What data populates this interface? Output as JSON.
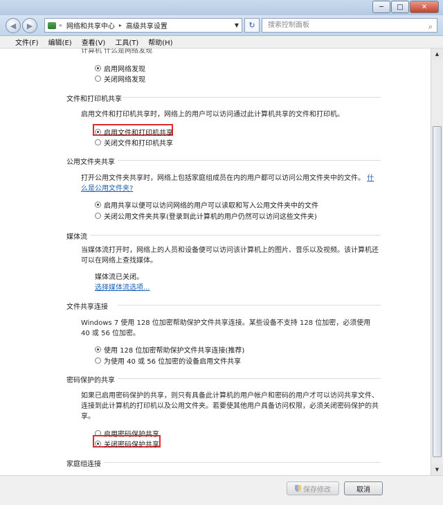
{
  "window": {
    "minimize": "─",
    "maximize": "□",
    "close": "✕"
  },
  "nav": {
    "back_icon": "◀",
    "forward_icon": "▶",
    "breadcrumb": [
      "«",
      "网络和共享中心",
      "▸",
      "高级共享设置"
    ],
    "refresh_icon": "↻",
    "search_placeholder": "搜索控制面板",
    "search_icon": "⌕"
  },
  "menu": [
    "文件(F)",
    "编辑(E)",
    "查看(V)",
    "工具(T)",
    "帮助(H)"
  ],
  "network_discovery": {
    "cut_label": "计算机  什么是网络发现",
    "options": [
      {
        "label": "启用网络发现",
        "selected": true
      },
      {
        "label": "关闭网络发现",
        "selected": false
      }
    ]
  },
  "file_printer": {
    "heading": "文件和打印机共享",
    "desc": "启用文件和打印机共享时，网络上的用户可以访问通过此计算机共享的文件和打印机。",
    "options": [
      {
        "label": "启用文件和打印机共享",
        "selected": true
      },
      {
        "label": "关闭文件和打印机共享",
        "selected": false
      }
    ]
  },
  "public_folder": {
    "heading": "公用文件夹共享",
    "desc": "打开公用文件夹共享时，网络上包括家庭组成员在内的用户都可以访问公用文件夹中的文件。",
    "link": "什么是公用文件夹?",
    "options": [
      {
        "label": "启用共享以便可以访问网络的用户可以读取和写入公用文件夹中的文件",
        "selected": true
      },
      {
        "label": "关闭公用文件夹共享(登录到此计算机的用户仍然可以访问这些文件夹)",
        "selected": false
      }
    ]
  },
  "media": {
    "heading": "媒体流",
    "desc": "当媒体流打开时，网络上的人员和设备便可以访问该计算机上的图片、音乐以及视频。该计算机还可以在网络上查找媒体。",
    "status": "媒体流已关闭。",
    "link": "选择媒体流选项..."
  },
  "file_sharing": {
    "heading": "文件共享连接",
    "desc": "Windows 7 使用 128 位加密帮助保护文件共享连接。某些设备不支持 128 位加密，必须使用 40 或 56 位加密。",
    "options": [
      {
        "label": "使用 128 位加密帮助保护文件共享连接(推荐)",
        "selected": true
      },
      {
        "label": "为使用 40 或 56 位加密的设备启用文件共享",
        "selected": false
      }
    ]
  },
  "password": {
    "heading": "密码保护的共享",
    "desc": "如果已启用密码保护的共享，则只有具备此计算机的用户帐户和密码的用户才可以访问共享文件、连接到此计算机的打印机以及公用文件夹。若要使其他用户具备访问权限，必须关闭密码保护的共享。",
    "options": [
      {
        "label": "启用密码保护共享",
        "selected": false
      },
      {
        "label": "关闭密码保护共享",
        "selected": true
      }
    ]
  },
  "homegroup": {
    "heading": "家庭组连接"
  },
  "buttons": {
    "save": "保存修改",
    "cancel": "取消"
  },
  "colors": {
    "highlight": "#e0292b",
    "link": "#1a5fb4"
  }
}
